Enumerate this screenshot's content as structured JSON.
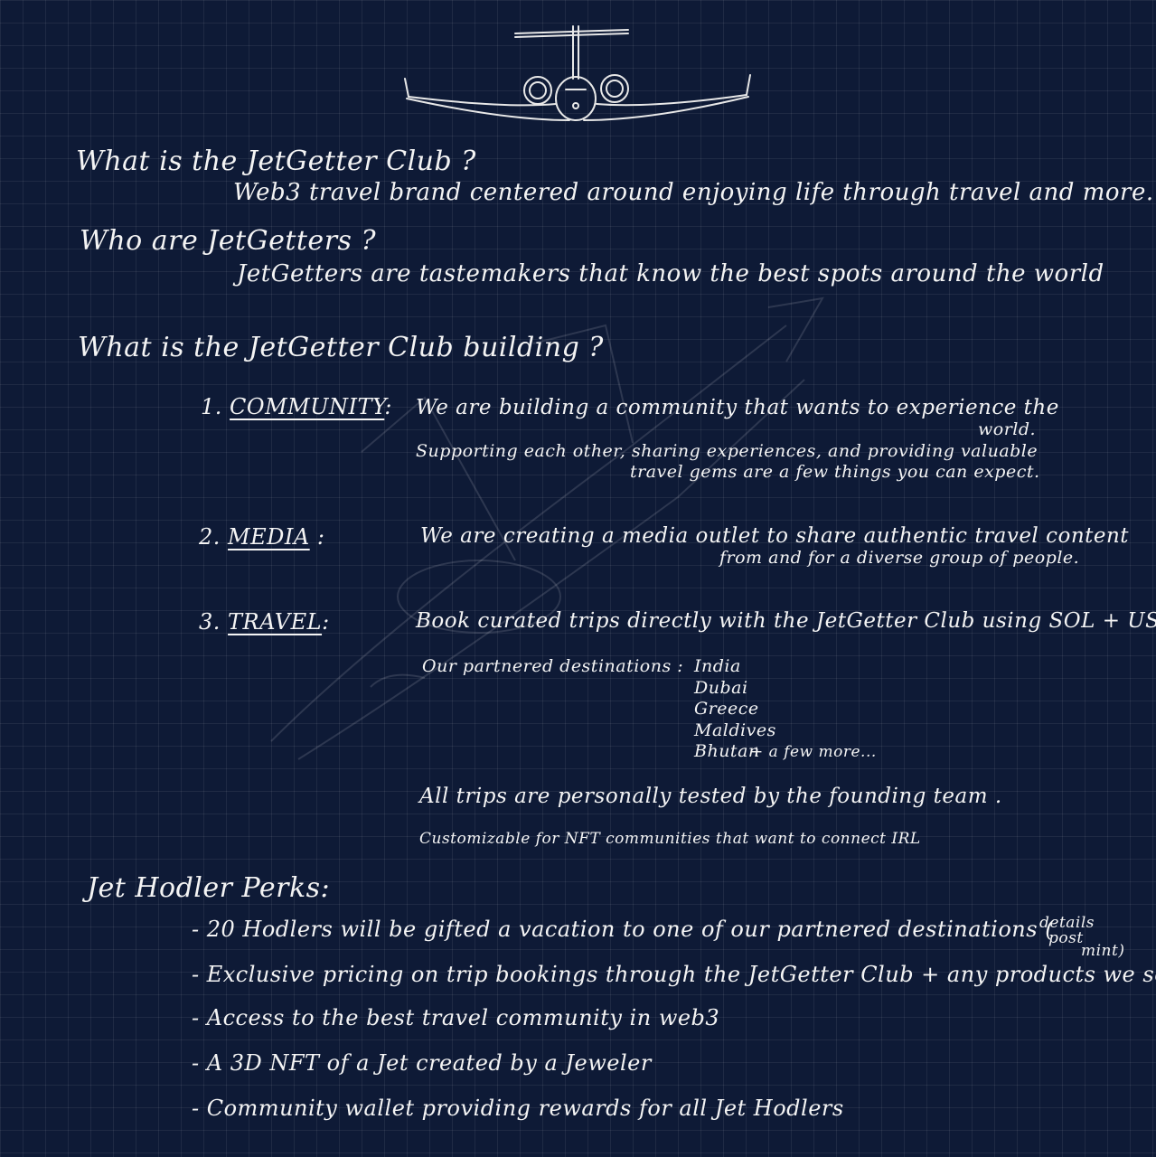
{
  "q1": {
    "question": "What is the JetGetter Club ?",
    "answer": "Web3 travel brand centered around enjoying life through travel and more..."
  },
  "q2": {
    "question": "Who are JetGetters ?",
    "answer": "JetGetters are tastemakers that know the best spots around the world"
  },
  "q3": {
    "question": "What is the JetGetter Club building ?"
  },
  "community": {
    "num": "1.",
    "label": "COMMUNITY",
    "colon": ":",
    "line1": "We are building a community that wants to experience the",
    "line1b": "world.",
    "line2": "Supporting each other, sharing experiences, and providing valuable",
    "line3": "travel gems are a few things you can expect."
  },
  "media": {
    "num": "2.",
    "label": "MEDIA",
    "colon": ":",
    "line1": "We are creating a media outlet to share authentic travel content",
    "line2": "from and for a diverse group of people."
  },
  "travel": {
    "num": "3.",
    "label": "TRAVEL",
    "colon": ":",
    "line1": "Book curated trips directly with the JetGetter Club using SOL + USD.",
    "dest_label": "Our partnered destinations :",
    "destinations": [
      "India",
      "Dubai",
      "Greece",
      "Maldives",
      "Bhutan"
    ],
    "dest_more": "+ a few more...",
    "tested": "All trips are personally tested by the founding team .",
    "custom": "Customizable for NFT communities that want to connect IRL"
  },
  "perks": {
    "title": "Jet Hodler Perks:",
    "items": [
      "- 20 Hodlers will be gifted a vacation to one of our partnered destinations (",
      "- Exclusive pricing on trip bookings through the JetGetter Club + any products we sell",
      "- Access to the best travel community in web3",
      "- A 3D NFT of a Jet created by a Jeweler",
      "- Community wallet providing rewards for all Jet Hodlers"
    ],
    "note": [
      "details",
      "post",
      "mint)"
    ]
  }
}
